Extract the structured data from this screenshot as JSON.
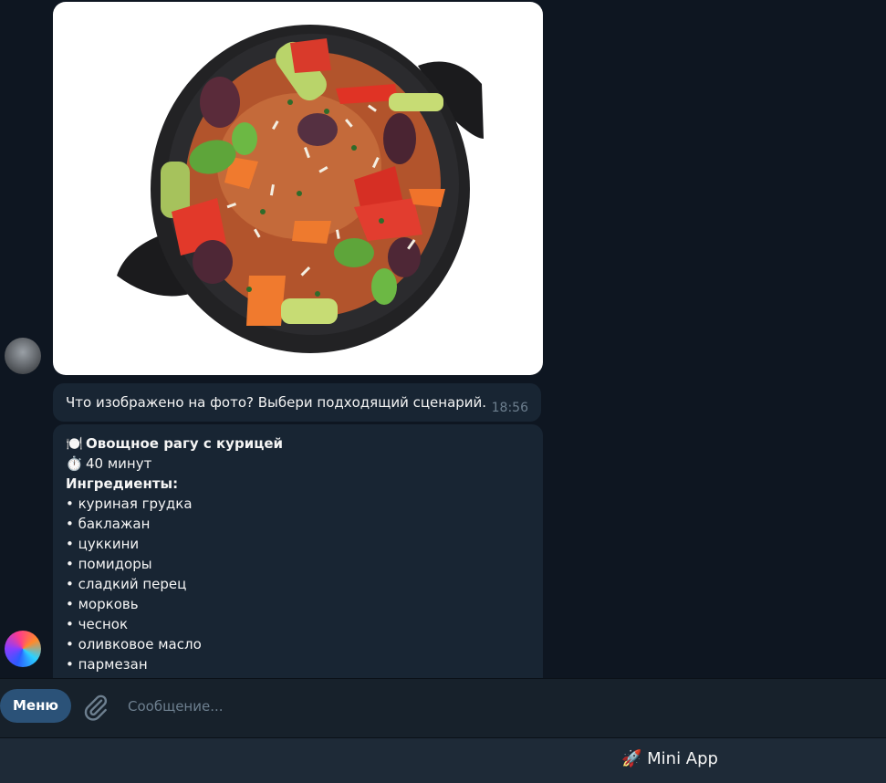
{
  "messages": {
    "question": {
      "text": "Что изображено на фото? Выбери подходящий сценарий.",
      "time": "18:56"
    },
    "recipe": {
      "title_emoji": "🍽️",
      "title": "Овощное рагу с курицей",
      "time_emoji": "⏱️",
      "time": "40 минут",
      "ingredients_header": "Ингредиенты:",
      "ingredients": [
        "• куриная грудка",
        "• баклажан",
        "• цуккини",
        "• помидоры",
        "• сладкий перец",
        "• морковь",
        "• чеснок",
        "• оливковое масло",
        "• пармезан"
      ]
    }
  },
  "composer": {
    "menu_label": "Меню",
    "placeholder": "Сообщение..."
  },
  "mini_app": {
    "label": "🚀 Mini App"
  }
}
